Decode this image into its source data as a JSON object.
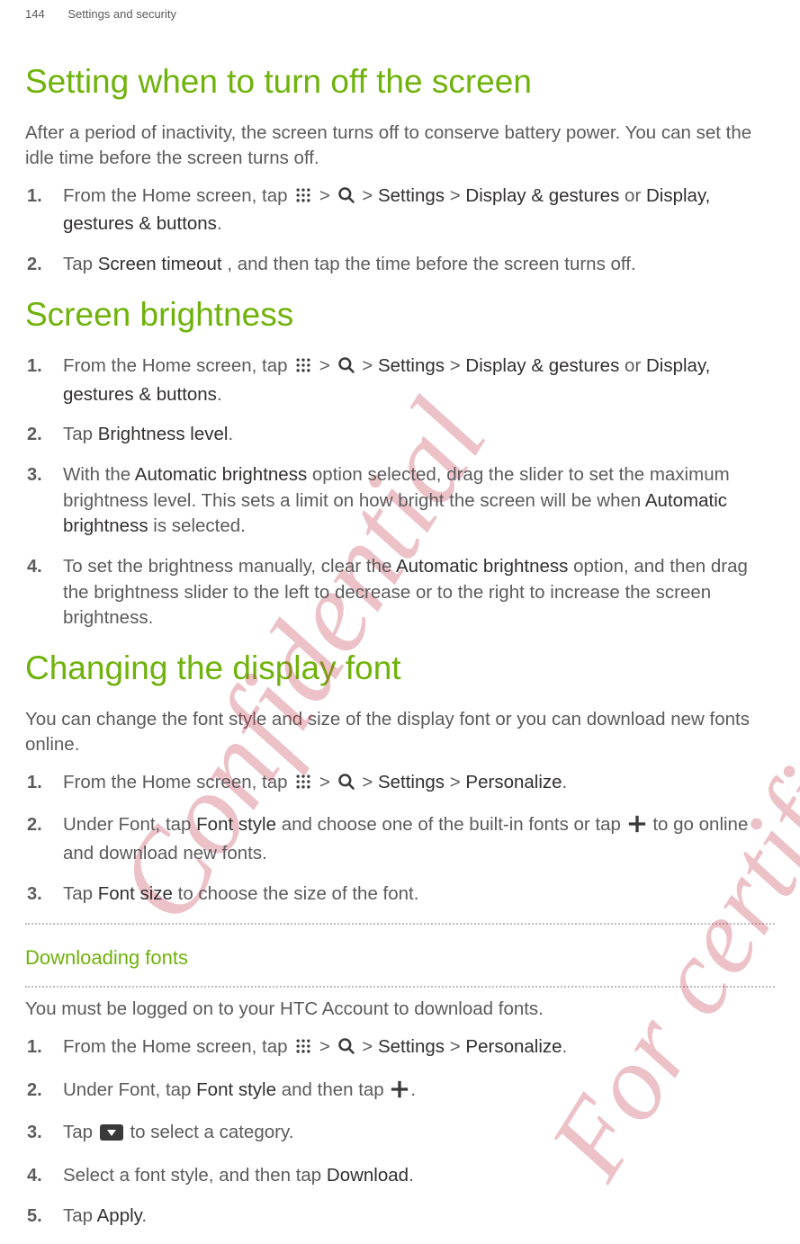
{
  "header": {
    "page_number": "144",
    "section_title": "Settings and security"
  },
  "ui_text": {
    "settings": "Settings",
    "display_gestures": "Display & gestures",
    "display_gestures_buttons": "Display, gestures & buttons",
    "personalize": "Personalize",
    "screen_timeout": "Screen timeout",
    "brightness_level": "Brightness level",
    "automatic_brightness": "Automatic brightness",
    "font_style": "Font style",
    "font_size": "Font size",
    "download": "Download",
    "apply": "Apply"
  },
  "sections": {
    "s1": {
      "title": "Setting when to turn off the screen",
      "intro": "After a period of inactivity, the screen turns off to conserve battery power. You can set the idle time before the screen turns off.",
      "step1_pre": "From the Home screen, tap ",
      "step1_post_or": " or ",
      "step2_pre": "Tap ",
      "step2_post": ", and then tap the time before the screen turns off."
    },
    "s2": {
      "title": "Screen brightness",
      "step1_pre": "From the Home screen, tap ",
      "step1_post_or": " or ",
      "step2_pre": "Tap ",
      "step3_pre": "With the ",
      "step3_mid": " option selected, drag the slider to set the maximum brightness level. This sets a limit on how bright the screen will be when ",
      "step3_post": " is selected.",
      "step4_pre": "To set the brightness manually, clear the ",
      "step4_post": " option, and then drag the brightness slider to the left to decrease or to the right to increase the screen brightness."
    },
    "s3": {
      "title": "Changing the display font",
      "intro": "You can change the font style and size of the display font or you can download new fonts online.",
      "step1_pre": "From the Home screen, tap ",
      "step2_pre": "Under Font, tap ",
      "step2_mid": " and choose one of the built-in fonts or tap ",
      "step2_post": " to go online and download new fonts.",
      "step3_pre": "Tap ",
      "step3_post": " to choose the size of the font."
    },
    "s4": {
      "title": "Downloading fonts",
      "intro": "You must be logged on to your HTC Account to download fonts.",
      "step1_pre": "From the Home screen, tap ",
      "step2_pre": "Under Font, tap ",
      "step2_mid": " and then tap ",
      "step3_pre": "Tap ",
      "step3_post": " to select a category.",
      "step4_pre": "Select a font style, and then tap ",
      "step5_pre": "Tap "
    }
  },
  "glyphs": {
    "gt": " > ",
    "period": "."
  },
  "watermarks": {
    "w1": "Confidential",
    "w2": "For certification only"
  }
}
